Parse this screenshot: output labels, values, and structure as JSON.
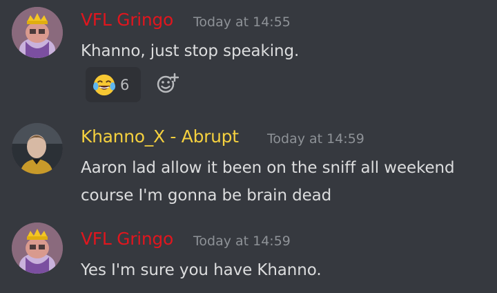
{
  "colors": {
    "background": "#36393f",
    "vfl_role": "#e0161e",
    "khanno_role": "#f4d03f",
    "timestamp": "#8e9297",
    "message_text": "#dcddde"
  },
  "messages": [
    {
      "author": "VFL Gringo",
      "timestamp": "Today at 14:55",
      "lines": [
        "Khanno, just stop speaking."
      ],
      "reaction": {
        "emoji": "joy-emoji",
        "count": "6"
      },
      "avatar_icon": "crowned-cartoon-avatar-icon"
    },
    {
      "author": "Khanno_X - Abrupt",
      "timestamp": "Today at 14:59",
      "lines": [
        "Aaron lad allow it been on the sniff all weekend",
        "course I'm gonna be brain dead"
      ],
      "avatar_icon": "football-player-avatar-icon"
    },
    {
      "author": "VFL Gringo",
      "timestamp": "Today at 14:59",
      "lines": [
        "Yes I'm sure you have Khanno."
      ],
      "avatar_icon": "crowned-cartoon-avatar-icon"
    }
  ]
}
